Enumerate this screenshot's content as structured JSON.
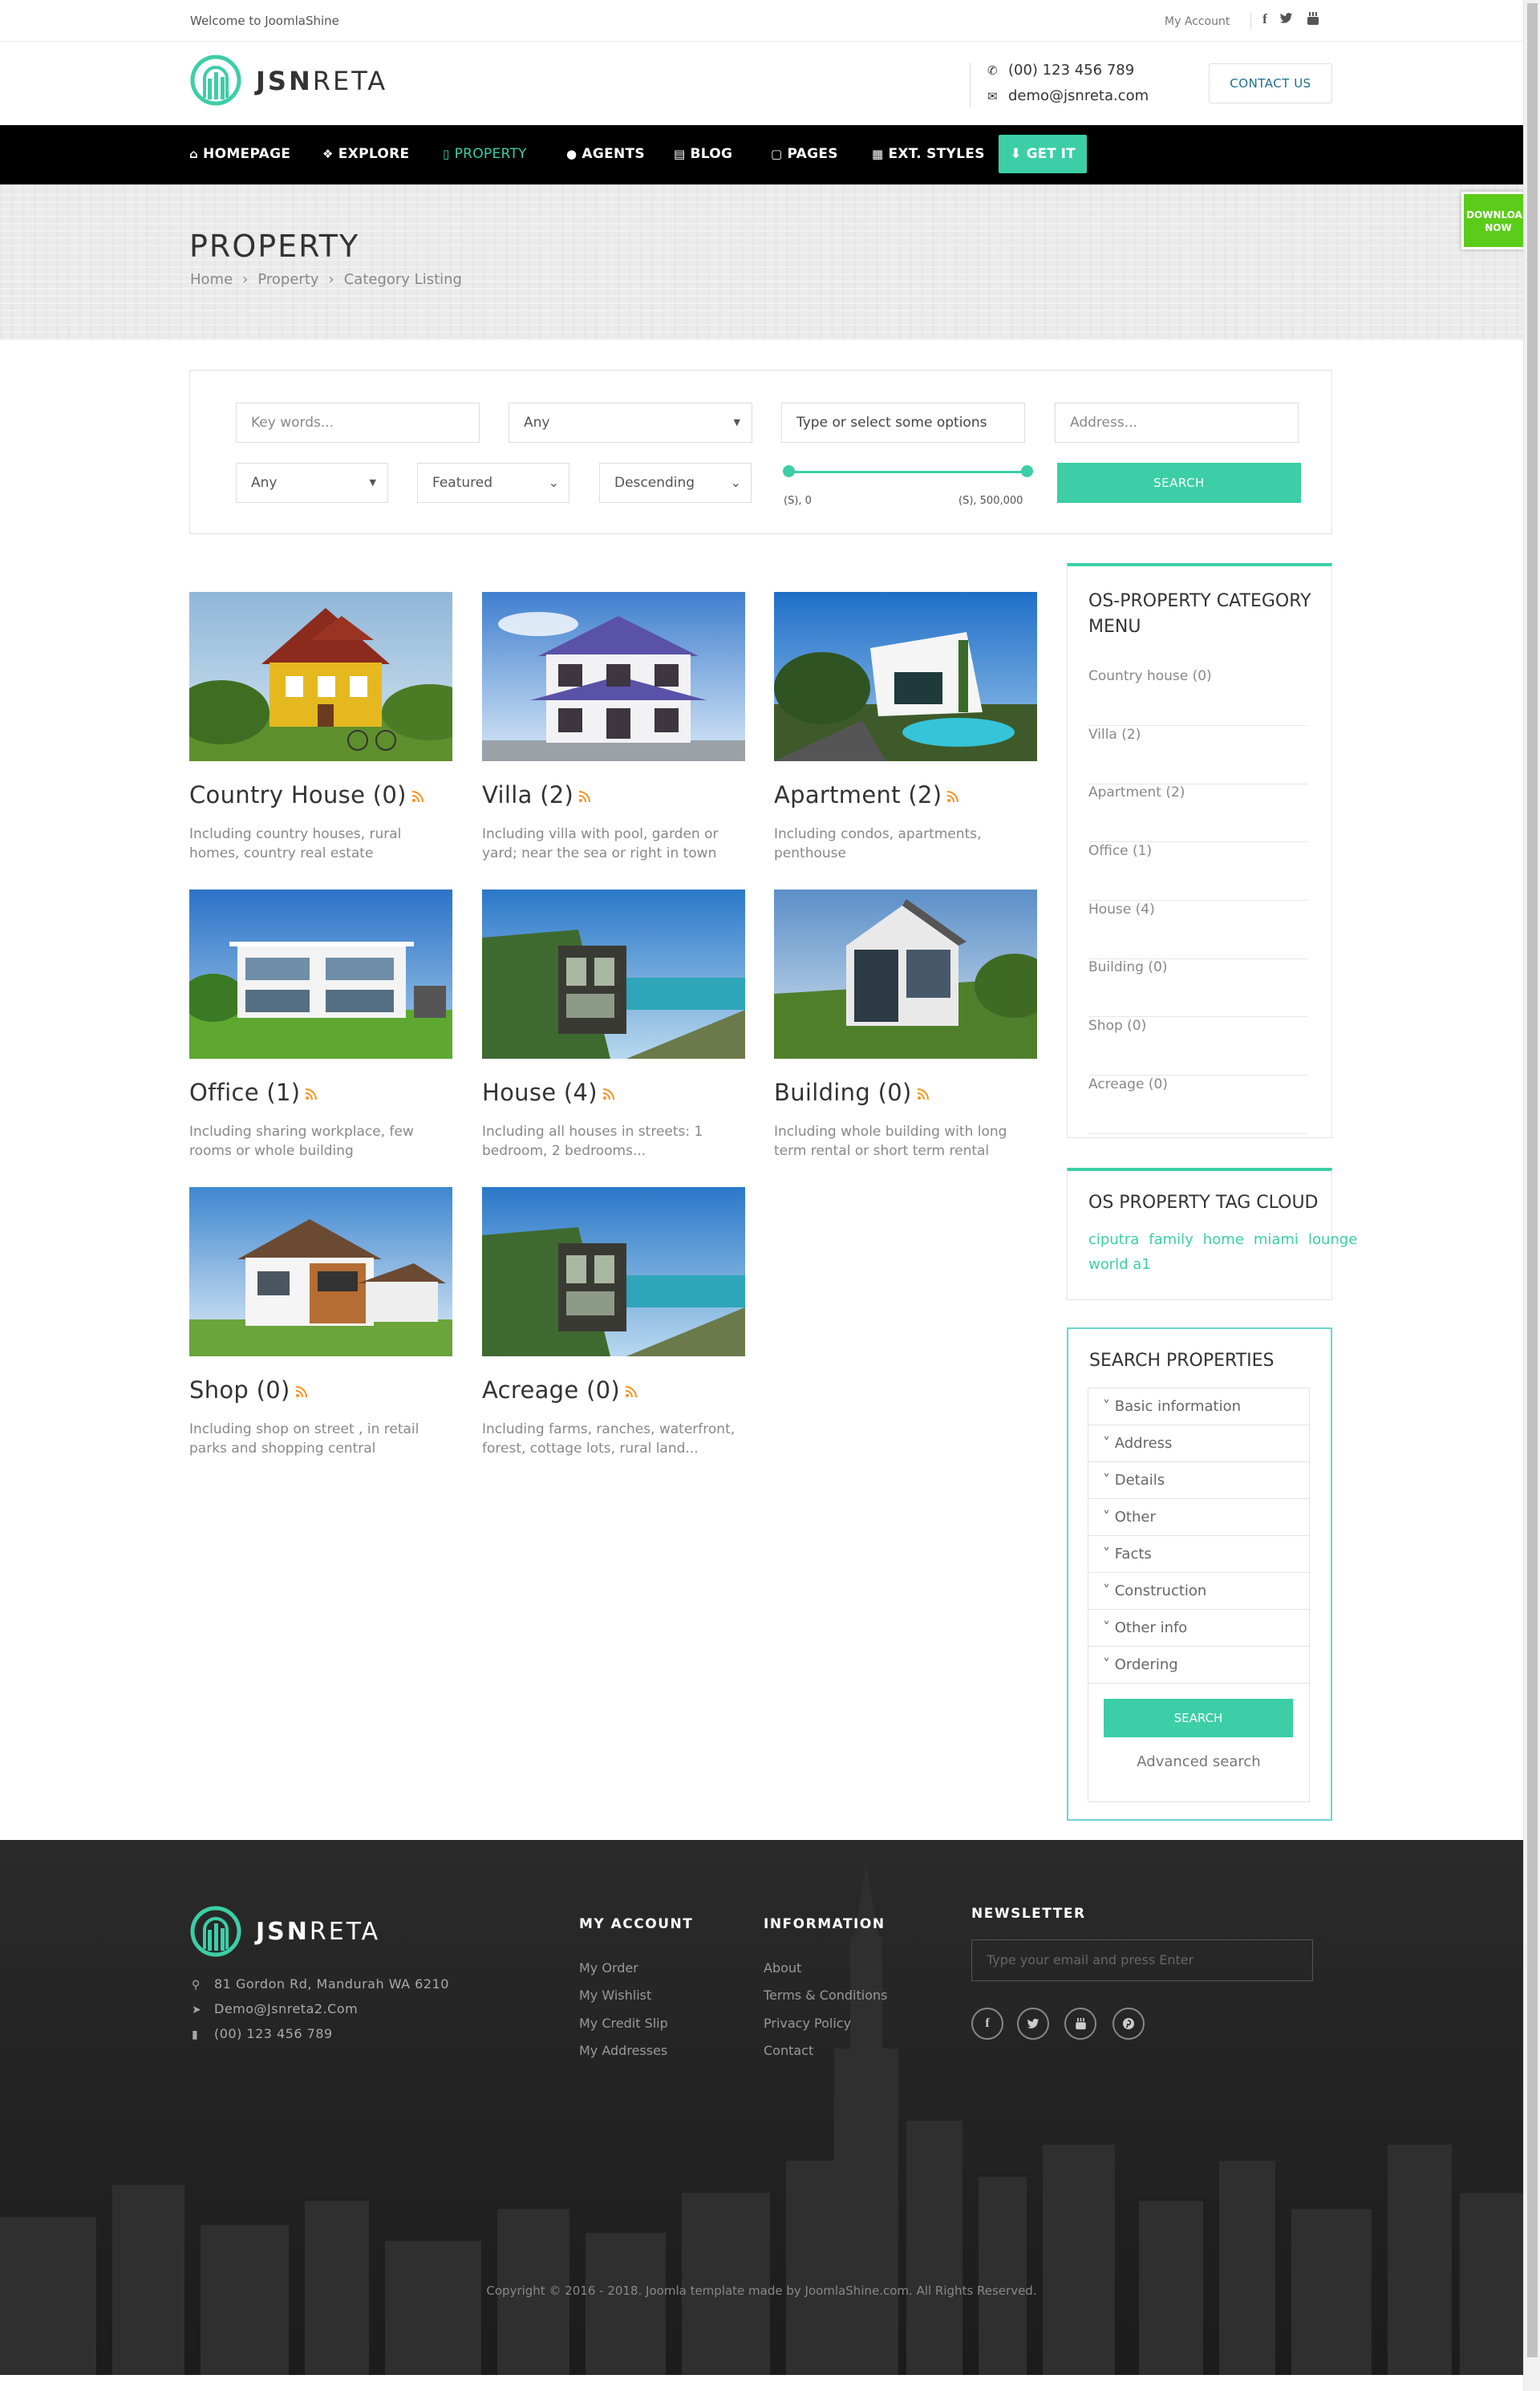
{
  "topbar": {
    "welcome": "Welcome to JoomlaShine",
    "my_account": "My Account",
    "social_icons": [
      "facebook-icon",
      "twitter-icon",
      "youtube-icon"
    ]
  },
  "header": {
    "logo_bold": "JSN",
    "logo_light": "RETA",
    "phone": "(00) 123 456 789",
    "email": "demo@jsnreta.com",
    "contact_button": "CONTACT US"
  },
  "nav": {
    "items": [
      {
        "label": "HOMEPAGE",
        "icon": "home-icon"
      },
      {
        "label": "EXPLORE",
        "icon": "cubes-icon"
      },
      {
        "label": "PROPERTY",
        "icon": "building-icon"
      },
      {
        "label": "AGENTS",
        "icon": "user-icon"
      },
      {
        "label": "BLOG",
        "icon": "newspaper-icon"
      },
      {
        "label": "PAGES",
        "icon": "file-icon"
      },
      {
        "label": "EXT. STYLES",
        "icon": "table-icon"
      }
    ],
    "get_it": "GET IT",
    "active_color": "#3ccea7"
  },
  "page_header": {
    "title": "PROPERTY",
    "breadcrumb": [
      "Home",
      "Property",
      "Category Listing"
    ]
  },
  "download_badge": {
    "line1": "DOWNLOAD",
    "line2": "NOW",
    "color": "#5ccc1b"
  },
  "search_form": {
    "keywords_placeholder": "Key words...",
    "category_value": "Any",
    "types_placeholder": "Type or select some options",
    "address_placeholder": "Address...",
    "type_value": "Any",
    "sort_value": "Featured",
    "order_value": "Descending",
    "price_min": "(S), 0",
    "price_max": "(S), 500,000",
    "search_button": "SEARCH"
  },
  "categories": [
    {
      "name": "Country House",
      "count": "(0)",
      "desc": "Including country houses, rural homes, country real estate"
    },
    {
      "name": "Villa",
      "count": "(2)",
      "desc": "Including villa with pool, garden or yard; near the sea or right in town"
    },
    {
      "name": "Apartment",
      "count": "(2)",
      "desc": "Including condos, apartments, penthouse"
    },
    {
      "name": "Office",
      "count": "(1)",
      "desc": "Including sharing workplace, few rooms or whole building"
    },
    {
      "name": "House",
      "count": "(4)",
      "desc": "Including all houses in streets: 1 bedroom, 2 bedrooms..."
    },
    {
      "name": "Building",
      "count": "(0)",
      "desc": "Including whole building with long term rental or short term rental"
    },
    {
      "name": "Shop",
      "count": "(0)",
      "desc": "Including shop on street , in retail parks and shopping central"
    },
    {
      "name": "Acreage",
      "count": "(0)",
      "desc": "Including farms, ranches, waterfront, forest, cottage lots, rural land..."
    }
  ],
  "sidebar": {
    "category_menu": {
      "title": "OS-PROPERTY CATEGORY MENU",
      "items": [
        "Country house (0)",
        "Villa (2)",
        "Apartment (2)",
        "Office (1)",
        "House (4)",
        "Building (0)",
        "Shop (0)",
        "Acreage (0)"
      ]
    },
    "tag_cloud": {
      "title": "OS PROPERTY TAG CLOUD",
      "tags": [
        "ciputra",
        "family",
        "home",
        "miami",
        "lounge world a1"
      ]
    },
    "search_properties": {
      "title": "SEARCH PROPERTIES",
      "sections": [
        "Basic information",
        "Address",
        "Details",
        "Other",
        "Facts",
        "Construction",
        "Other info",
        "Ordering"
      ],
      "search_button": "SEARCH",
      "advanced": "Advanced search"
    }
  },
  "footer": {
    "logo_bold": "JSN",
    "logo_light": "RETA",
    "address": "81 Gordon Rd, Mandurah WA 6210",
    "email": "Demo@Jsnreta2.Com",
    "phone": "(00) 123 456 789",
    "my_account": {
      "title": "MY ACCOUNT",
      "links": [
        "My Order",
        "My Wishlist",
        "My Credit Slip",
        "My Addresses"
      ]
    },
    "information": {
      "title": "INFORMATION",
      "links": [
        "About",
        "Terms & Conditions",
        "Privacy Policy",
        "Contact"
      ]
    },
    "newsletter": {
      "title": "NEWSLETTER",
      "placeholder": "Type your email and press Enter"
    },
    "social_icons": [
      "facebook-icon",
      "twitter-icon",
      "youtube-icon",
      "pinterest-icon"
    ],
    "copyright": "Copyright © 2016 - 2018. Joomla template made by JoomlaShine.com. All Rights Reserved."
  }
}
